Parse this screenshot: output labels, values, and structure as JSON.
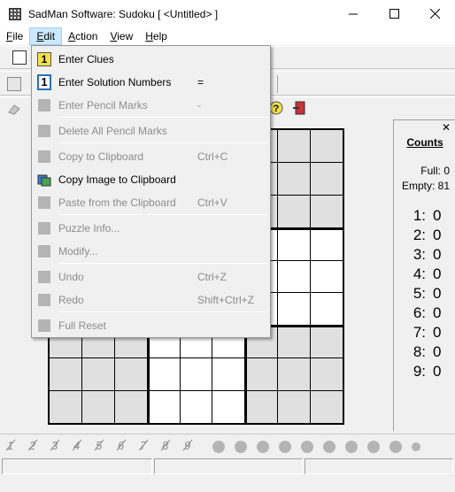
{
  "window": {
    "title": "SadMan Software: Sudoku [ <Untitled> ]",
    "minimize_label": "—",
    "maximize_label": "☐",
    "close_label": "✕"
  },
  "menubar": {
    "items": [
      {
        "label": "File",
        "mnemonic": "F"
      },
      {
        "label": "Edit",
        "mnemonic": "E"
      },
      {
        "label": "Action",
        "mnemonic": "A"
      },
      {
        "label": "View",
        "mnemonic": "V"
      },
      {
        "label": "Help",
        "mnemonic": "H"
      }
    ]
  },
  "edit_menu": {
    "items": [
      {
        "label": "Enter Clues",
        "shortcut": "",
        "enabled": true,
        "icon": "clue-one-icon"
      },
      {
        "label": "Enter Solution Numbers",
        "shortcut": "=",
        "enabled": true,
        "icon": "solution-one-icon"
      },
      {
        "label": "Enter Pencil Marks",
        "shortcut": "-",
        "enabled": false,
        "icon": "pencil-marks-icon"
      },
      {
        "label": "Delete All Pencil Marks",
        "shortcut": "",
        "enabled": false,
        "icon": "delete-marks-icon"
      },
      {
        "label": "Copy to Clipboard",
        "shortcut": "Ctrl+C",
        "enabled": false,
        "icon": "copy-icon"
      },
      {
        "label": "Copy Image to Clipboard",
        "shortcut": "",
        "enabled": true,
        "icon": "copy-image-icon"
      },
      {
        "label": "Paste from the Clipboard",
        "shortcut": "Ctrl+V",
        "enabled": false,
        "icon": "paste-icon"
      },
      {
        "label": "Puzzle Info...",
        "shortcut": "",
        "enabled": false,
        "icon": "puzzle-info-icon"
      },
      {
        "label": "Modify...",
        "shortcut": "",
        "enabled": false,
        "icon": "modify-icon"
      },
      {
        "label": "Undo",
        "shortcut": "Ctrl+Z",
        "enabled": false,
        "icon": "undo-icon"
      },
      {
        "label": "Redo",
        "shortcut": "Shift+Ctrl+Z",
        "enabled": false,
        "icon": "redo-icon"
      },
      {
        "label": "Full Reset",
        "shortcut": "",
        "enabled": false,
        "icon": "full-reset-icon"
      }
    ]
  },
  "counts_panel": {
    "title": "Counts",
    "close_label": "✕",
    "full_label": "Full:",
    "full_value": "0",
    "empty_label": "Empty:",
    "empty_value": "81",
    "digits": [
      {
        "digit": "1:",
        "count": "0"
      },
      {
        "digit": "2:",
        "count": "0"
      },
      {
        "digit": "3:",
        "count": "0"
      },
      {
        "digit": "4:",
        "count": "0"
      },
      {
        "digit": "5:",
        "count": "0"
      },
      {
        "digit": "6:",
        "count": "0"
      },
      {
        "digit": "7:",
        "count": "0"
      },
      {
        "digit": "8:",
        "count": "0"
      },
      {
        "digit": "9:",
        "count": "0"
      }
    ]
  },
  "pencil_bar": {
    "digits": [
      "1",
      "2",
      "3",
      "4",
      "5",
      "6",
      "7",
      "8",
      "9"
    ],
    "marker_count": 10
  },
  "colors": {
    "menu_highlight": "#cce8ff",
    "grey_cell": "#e0e0e0",
    "white_cell": "#ffffff",
    "disabled_text": "#8c8c8c"
  }
}
